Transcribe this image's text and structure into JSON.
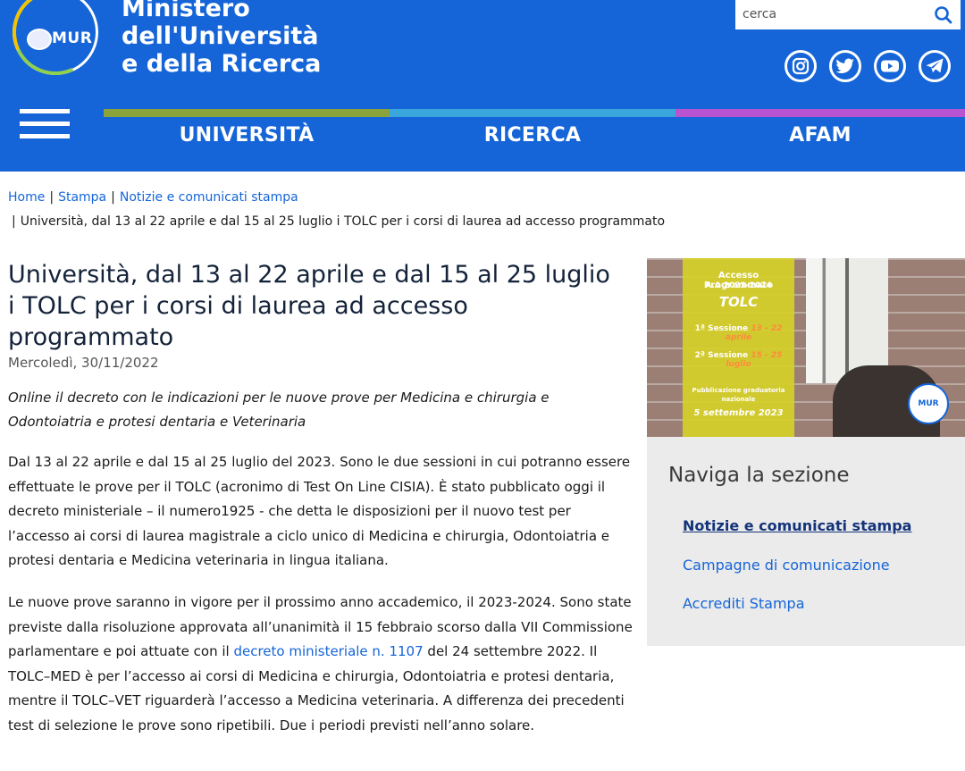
{
  "header": {
    "logo_text": "MUR",
    "ministry_lines": [
      "Ministero",
      "dell'Università",
      "e della Ricerca"
    ],
    "search_placeholder": "cerca",
    "social_icons": [
      "instagram-icon",
      "twitter-icon",
      "youtube-icon",
      "telegram-icon"
    ]
  },
  "nav": {
    "items": [
      {
        "label": "UNIVERSITÀ",
        "color": "#8aa33a"
      },
      {
        "label": "RICERCA",
        "color": "#3aa7dc"
      },
      {
        "label": "AFAM",
        "color": "#b853d1"
      }
    ]
  },
  "breadcrumb": {
    "items": [
      "Home",
      "Stampa",
      "Notizie e comunicati stampa"
    ],
    "current": "Università, dal 13 al 22 aprile e dal 15 al 25 luglio i TOLC per i corsi di laurea ad accesso programmato"
  },
  "article": {
    "title": "Università, dal 13 al 22 aprile e dal 15 al 25 luglio i TOLC per i corsi di laurea ad accesso programmato",
    "date": "Mercoledì, 30/11/2022",
    "subtitle": "Online il decreto con le indicazioni per le nuove prove per Medicina e chirurgia e Odontoiatria e protesi dentaria e Veterinaria",
    "p1": "Dal 13 al 22 aprile e dal 15 al 25 luglio del 2023. Sono le due sessioni in cui potranno essere effettuate le prove per il TOLC (acronimo di Test On Line CISIA). È stato pubblicato oggi il decreto ministeriale – il numero1925 - che detta le disposizioni per il nuovo test per l’accesso ai corsi di laurea magistrale a ciclo unico di Medicina e chirurgia, Odontoiatria e protesi dentaria e Medicina veterinaria in lingua italiana.",
    "p2_before": "Le nuove prove saranno in vigore per il prossimo anno accademico, il 2023-2024. Sono state previste dalla risoluzione approvata all’unanimità il 15 febbraio scorso dalla VII Commissione parlamentare e poi attuate con il ",
    "p2_link": "decreto ministeriale n. 1107",
    "p2_after": " del 24 settembre 2022. Il TOLC–MED è per l’accesso ai corsi di Medicina e chirurgia, Odontoiatria e protesi dentaria, mentre il TOLC–VET riguarderà l’accesso a Medicina veterinaria. A differenza dei precedenti test di selezione le prove sono ripetibili. Due i periodi previsti nell’anno solare."
  },
  "banner": {
    "line1": "Accesso Programmato",
    "line2": "A.A 2023-2024",
    "line3": "TOLC",
    "session1_label": "1ª Sessione",
    "session1_dates": "13 - 22 aprile",
    "session2_label": "2ª Sessione",
    "session2_dates": "15 - 25 luglio",
    "pub1": "Pubblicazione graduatoria",
    "pub2": "nazionale",
    "pub_date": "5 settembre 2023",
    "badge": "MUR"
  },
  "sidebar": {
    "title": "Naviga la sezione",
    "links": [
      "Notizie e comunicati stampa",
      "Campagne di comunicazione",
      "Accrediti Stampa"
    ]
  }
}
